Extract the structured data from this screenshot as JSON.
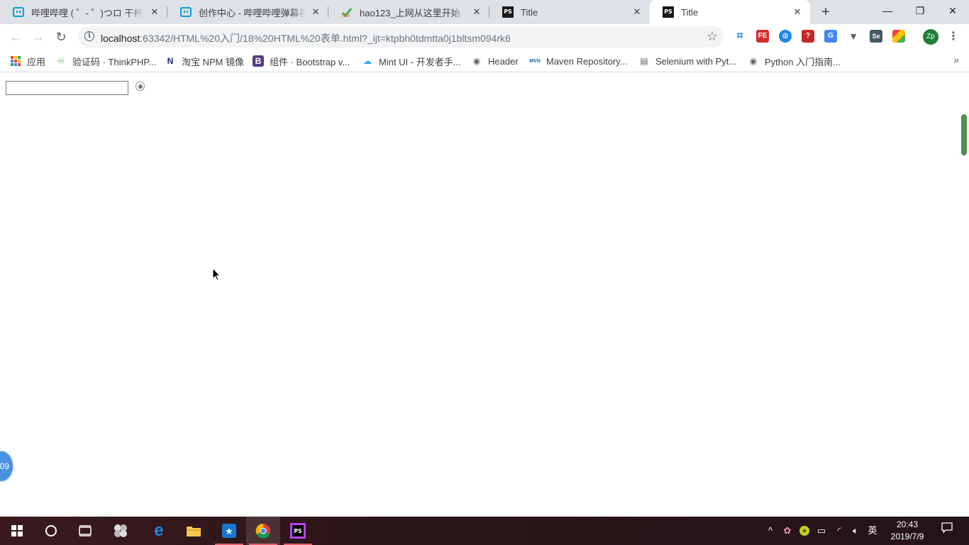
{
  "browser": {
    "tabs": [
      {
        "title": "哔哩哔哩 ( ゜- ゜)つロ 干杯~-bilibili",
        "icon": "bilibili-icon",
        "active": false
      },
      {
        "title": "创作中心 - 哔哩哔哩弹幕视频网",
        "icon": "bilibili-icon",
        "active": false
      },
      {
        "title": "hao123_上网从这里开始",
        "icon": "hao123-icon",
        "active": false
      },
      {
        "title": "Title",
        "icon": "phpstorm-icon",
        "active": false
      },
      {
        "title": "Title",
        "icon": "phpstorm-icon",
        "active": true
      }
    ],
    "close_glyph": "✕",
    "new_tab_glyph": "+",
    "window_controls": {
      "minimize": "—",
      "restore": "❐",
      "close": "✕"
    },
    "address": {
      "host": "localhost",
      "rest": ":63342/HTML%20入门/18%20HTML%20表单.html?_ijt=ktpbh0tdmtta0j1bltsm094rk6"
    },
    "profile_initials": "Zp",
    "extensions": [
      "hashtag-icon",
      "fe-icon",
      "globe-icon",
      "red-app-icon",
      "translate-icon",
      "vue-icon",
      "selenium-icon",
      "colorful-app-icon"
    ]
  },
  "bookmarks": [
    {
      "label": "应用",
      "icon": "apps-grid-icon"
    },
    {
      "label": "验证码 · ThinkPHP...",
      "icon": "thinkphp-icon"
    },
    {
      "label": "淘宝 NPM 镜像",
      "icon": "npm-icon"
    },
    {
      "label": "组件 · Bootstrap v...",
      "icon": "bootstrap-icon"
    },
    {
      "label": "Mint UI - 开发者手...",
      "icon": "cloud-icon"
    },
    {
      "label": "Header",
      "icon": "globe-icon"
    },
    {
      "label": "Maven Repository...",
      "icon": "maven-icon"
    },
    {
      "label": "Selenium with Pyt...",
      "icon": "doc-icon"
    },
    {
      "label": "Python 入门指南...",
      "icon": "globe-icon"
    }
  ],
  "page": {
    "input_value": "",
    "radio_checked": true,
    "badge_text": "09"
  },
  "taskbar": {
    "clock_time": "20:43",
    "clock_date": "2019/7/9",
    "ime": "英",
    "apps": [
      "start-icon",
      "cortana-icon",
      "task-view-icon",
      "app-icon",
      "edge-icon",
      "file-explorer-icon",
      "store-icon",
      "chrome-icon",
      "phpstorm-icon"
    ]
  },
  "colors": {
    "accent_blue": "#4a90e2",
    "profile_green": "#1e7e34",
    "taskbar_bg": "#2b1518"
  }
}
